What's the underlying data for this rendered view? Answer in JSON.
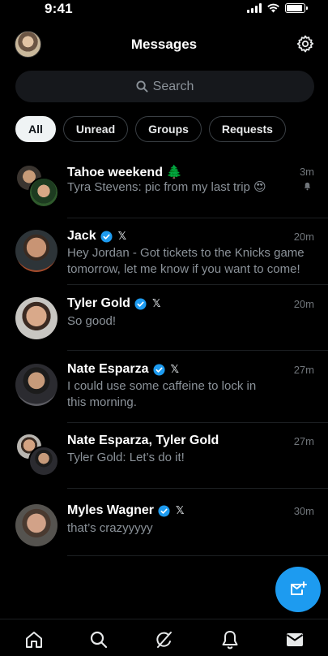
{
  "status_bar": {
    "time": "9:41",
    "battery_level": 0.9
  },
  "header": {
    "title": "Messages",
    "profile_icon": "avatar",
    "settings_icon": "gear-icon"
  },
  "search": {
    "placeholder": "Search",
    "icon": "search-icon"
  },
  "filters": [
    {
      "label": "All",
      "selected": true
    },
    {
      "label": "Unread",
      "selected": false
    },
    {
      "label": "Groups",
      "selected": false
    },
    {
      "label": "Requests",
      "selected": false
    }
  ],
  "conversations": [
    {
      "name": "Tahoe weekend 🌲",
      "verified": false,
      "x_badge": "",
      "time": "3m",
      "preview": "Tyra Stevens: pic from my last trip 😍",
      "muted": true,
      "group": true
    },
    {
      "name": "Jack",
      "verified": true,
      "x_badge": "𝕏",
      "time": "20m",
      "preview": "Hey Jordan - Got tickets to the Knicks game tomorrow, let me know if you want to come!",
      "muted": false,
      "group": false
    },
    {
      "name": "Tyler Gold",
      "verified": true,
      "x_badge": "𝕏",
      "time": "20m",
      "preview": "So good!",
      "muted": false,
      "group": false
    },
    {
      "name": "Nate Esparza",
      "verified": true,
      "x_badge": "𝕏",
      "time": "27m",
      "preview": "I could use some caffeine to lock in this morning.",
      "muted": false,
      "group": false
    },
    {
      "name": "Nate Esparza, Tyler Gold",
      "verified": false,
      "x_badge": "",
      "time": "27m",
      "preview": "Tyler Gold: Let’s do it!",
      "muted": false,
      "group": true
    },
    {
      "name": "Myles Wagner",
      "verified": true,
      "x_badge": "𝕏",
      "time": "30m",
      "preview": "that’s crazyyyyy",
      "muted": false,
      "group": false
    }
  ],
  "fab": {
    "icon": "new-message-icon"
  },
  "tabbar": {
    "items": [
      "home-icon",
      "search-icon",
      "grok-icon",
      "notifications-icon",
      "messages-icon"
    ],
    "active": "messages-icon"
  },
  "colors": {
    "accent": "#1d9bf0",
    "background": "#000000",
    "secondary_text": "#8b9299"
  }
}
